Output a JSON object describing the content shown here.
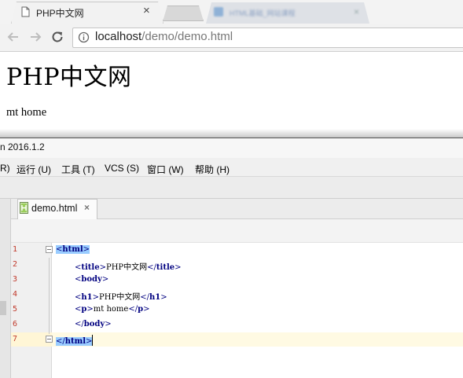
{
  "browser": {
    "active_tab_title": "PHP中文网",
    "background_tab_title": "HTML基础_网站课程",
    "url_host": "localhost",
    "url_path": "/demo/demo.html"
  },
  "rendered_page": {
    "heading": "PHP中文网",
    "paragraph": "mt home"
  },
  "ide": {
    "title_fragment": "n 2016.1.2",
    "menu": [
      {
        "label": "R)"
      },
      {
        "label": "运行 (U)"
      },
      {
        "label": "工具 (T)"
      },
      {
        "label": "VCS (S)"
      },
      {
        "label": "窗口 (W)"
      },
      {
        "label": "帮助 (H)"
      }
    ],
    "editor_tab": {
      "label": "demo.html",
      "close": "×"
    },
    "line_numbers": [
      "1",
      "2",
      "3",
      "4",
      "5",
      "6",
      "7"
    ],
    "code": {
      "l1_tag": "html",
      "l2_open": "title",
      "l2_text": "PHP中文网",
      "l2_close": "title",
      "l3_tag": "body",
      "l4_open": "h1",
      "l4_text": "PHP中文网",
      "l4_close": "h1",
      "l5_open": "p",
      "l5_text": "mt home",
      "l5_close": "p",
      "l6_tag": "body",
      "l7_tag": "html"
    }
  },
  "colors": {
    "line_number": "#c0392b",
    "tag": "#000080",
    "selection": "#99ccff",
    "caret_row": "#fffae3"
  }
}
